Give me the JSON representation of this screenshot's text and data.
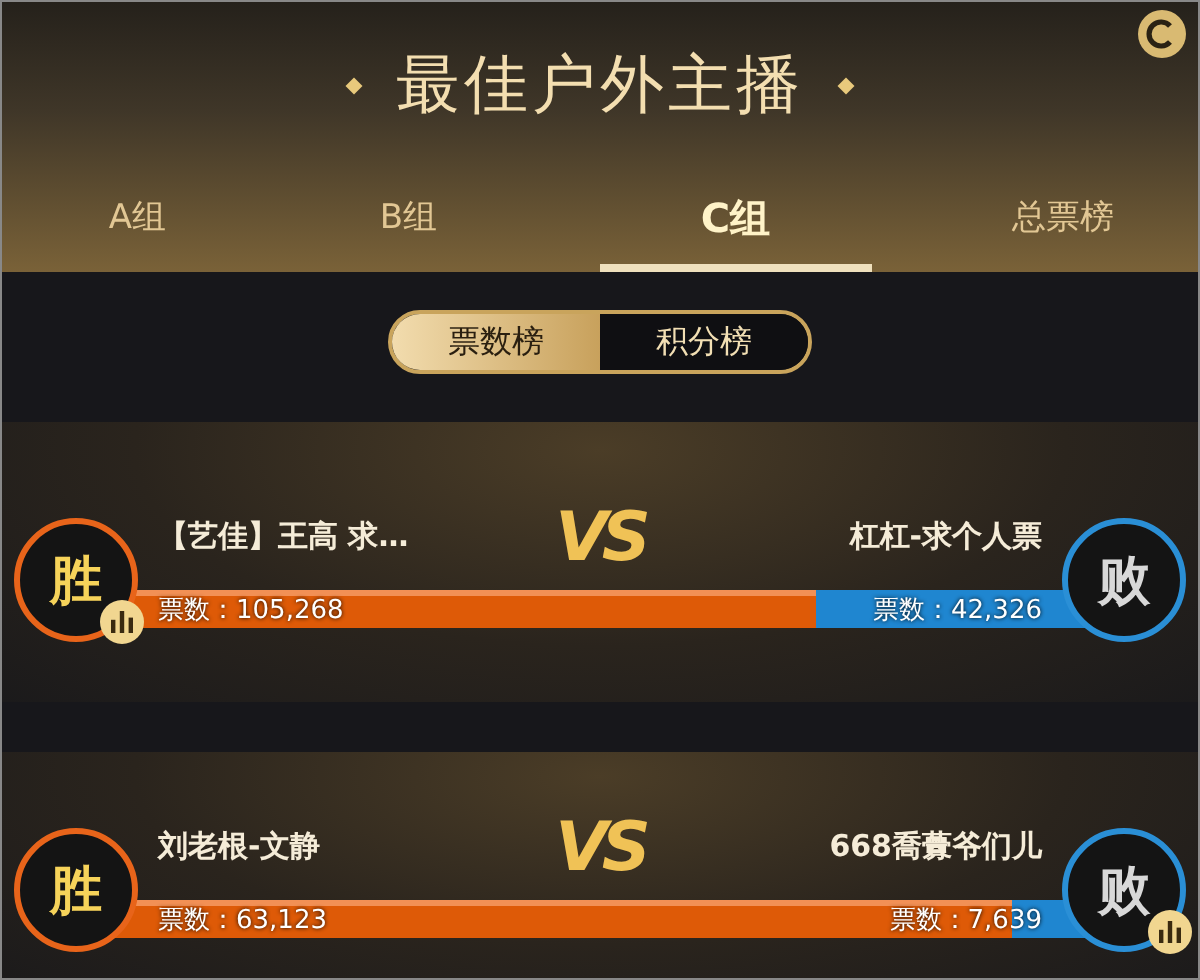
{
  "title": "最佳户外主播",
  "tabs": [
    {
      "label": "A组",
      "selected": false
    },
    {
      "label": "B组",
      "selected": false
    },
    {
      "label": "C组",
      "selected": true
    },
    {
      "label": "总票榜",
      "selected": false
    }
  ],
  "toggle": [
    {
      "label": "票数榜",
      "selected": true
    },
    {
      "label": "积分榜",
      "selected": false
    }
  ],
  "matches": [
    {
      "vs": "VS",
      "level": 0.72,
      "left": {
        "name": "【艺佳】王高 求…",
        "votes": "票数：105,268",
        "color": "#e8641a",
        "badge": "胜",
        "stats": true
      },
      "right": {
        "name": "杠杠-求个人票",
        "votes": "票数：42,326",
        "color": "#2a8fd6",
        "badge": "败",
        "stats": false
      }
    },
    {
      "vs": "VS",
      "level": 0.92,
      "left": {
        "name": "刘老根-文静",
        "votes": "票数：63,123",
        "color": "#e8641a",
        "badge": "胜",
        "stats": false
      },
      "right": {
        "name": "668喬虋爷们儿",
        "votes": "票数：7,639",
        "color": "#2a8fd6",
        "badge": "败",
        "stats": true
      }
    }
  ]
}
